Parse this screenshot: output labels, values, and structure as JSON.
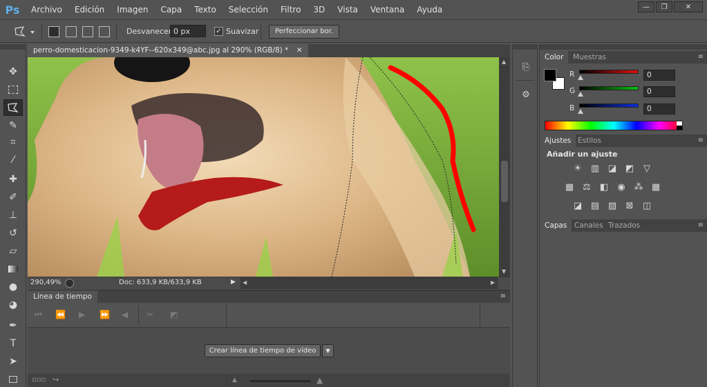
{
  "app": {
    "logo": "Ps"
  },
  "menu": [
    "Archivo",
    "Edición",
    "Imagen",
    "Capa",
    "Texto",
    "Selección",
    "Filtro",
    "3D",
    "Vista",
    "Ventana",
    "Ayuda"
  ],
  "window_controls": {
    "minimize": "—",
    "restore": "❐",
    "close": "✕"
  },
  "options": {
    "feather_label": "Desvanecer:",
    "feather_value": "0 px",
    "antialias_label": "Suavizar",
    "antialias_checked": "✓",
    "refine_button": "Perfeccionar bor."
  },
  "document": {
    "tab_title": "perro-domesticacion-9349-k4YF--620x349@abc.jpg al 290% (RGB/8) *",
    "close": "✕",
    "zoom": "290,49%",
    "doc_info": "Doc: 633,9 KB/633,9 KB"
  },
  "timeline": {
    "tab_label": "Línea de tiempo",
    "create_button": "Crear línea de tiempo de vídeo"
  },
  "color_panel": {
    "tabs": [
      "Color",
      "Muestras"
    ],
    "sliders": [
      {
        "label": "R",
        "value": "0",
        "color": "#e01010"
      },
      {
        "label": "G",
        "value": "0",
        "color": "#10c010"
      },
      {
        "label": "B",
        "value": "0",
        "color": "#1030e0"
      }
    ],
    "foreground": "#000000",
    "background": "#ffffff"
  },
  "adjust_panel": {
    "tabs": [
      "Ajustes",
      "Estilos"
    ],
    "heading": "Añadir un ajuste"
  },
  "layers_panel": {
    "tabs": [
      "Capas",
      "Canales",
      "Trazados"
    ]
  }
}
